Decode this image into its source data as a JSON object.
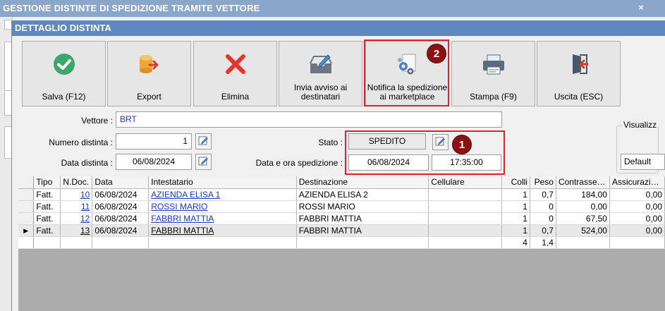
{
  "outer_window": {
    "title": "GESTIONE DISTINTE DI SPEDIZIONE TRAMITE VETTORE",
    "close_glyph": "×"
  },
  "dialog": {
    "title": "DETTAGLIO DISTINTA"
  },
  "toolbar": [
    {
      "id": "save",
      "label": "Salva (F12)",
      "icon": "check-circle-icon"
    },
    {
      "id": "export",
      "label": "Export",
      "icon": "export-database-icon"
    },
    {
      "id": "delete",
      "label": "Elimina",
      "icon": "red-x-icon"
    },
    {
      "id": "notify-recipients",
      "label": "Invia avviso ai destinatari",
      "icon": "inbox-pen-icon"
    },
    {
      "id": "notify-marketplace",
      "label": "Notifica la spedizione ai marketplace",
      "icon": "gears-doc-icon"
    },
    {
      "id": "print",
      "label": "Stampa (F9)",
      "icon": "printer-icon"
    },
    {
      "id": "exit",
      "label": "Uscita (ESC)",
      "icon": "exit-door-icon"
    }
  ],
  "badges": {
    "one": "1",
    "two": "2"
  },
  "form": {
    "vettore_label": "Vettore :",
    "vettore_value": "BRT",
    "numero_label": "Numero distinta :",
    "numero_value": "1",
    "data_label": "Data distinta :",
    "data_value": "06/08/2024",
    "stato_label": "Stato :",
    "stato_value": "SPEDITO",
    "spedizione_label": "Data e ora spedizione :",
    "spedizione_date": "06/08/2024",
    "spedizione_time": "17:35:00",
    "visualizza_label": "Visualizz",
    "visualizza_value": "Default"
  },
  "grid": {
    "columns": [
      "Tipo",
      "N.Doc.",
      "Data",
      "Intestatario",
      "Destinazione",
      "Cellulare",
      "Colli",
      "Peso",
      "Contrasse…",
      "Assicurazi…"
    ],
    "rows": [
      {
        "tipo": "Fatt.",
        "ndoc": "10",
        "data": "06/08/2024",
        "intestatario": "AZIENDA ELISA 1",
        "destinazione": "AZIENDA ELISA 2",
        "cellulare": "",
        "colli": "1",
        "peso": "0,7",
        "contrassegno": "184,00",
        "assicurazione": "0,00"
      },
      {
        "tipo": "Fatt.",
        "ndoc": "11",
        "data": "06/08/2024",
        "intestatario": "ROSSI MARIO",
        "destinazione": "ROSSI MARIO",
        "cellulare": "",
        "colli": "1",
        "peso": "0",
        "contrassegno": "0,00",
        "assicurazione": "0,00"
      },
      {
        "tipo": "Fatt.",
        "ndoc": "12",
        "data": "06/08/2024",
        "intestatario": "FABBRI MATTIA",
        "destinazione": "FABBRI MATTIA",
        "cellulare": "",
        "colli": "1",
        "peso": "0",
        "contrassegno": "67,50",
        "assicurazione": "0,00"
      },
      {
        "tipo": "Fatt.",
        "ndoc": "13",
        "data": "06/08/2024",
        "intestatario": "FABBRI MATTIA",
        "destinazione": "FABBRI MATTIA",
        "cellulare": "",
        "colli": "1",
        "peso": "0,7",
        "contrassegno": "524,00",
        "assicurazione": "0,00"
      }
    ],
    "current_row_marker": "▶",
    "totals": {
      "colli": "4",
      "peso": "1,4"
    }
  },
  "colors": {
    "title_bar": "#5e88bf",
    "outer_title_bar": "#8aa6c9",
    "highlight": "#e0202a",
    "badge": "#8b1212",
    "link": "#1a37c8"
  }
}
